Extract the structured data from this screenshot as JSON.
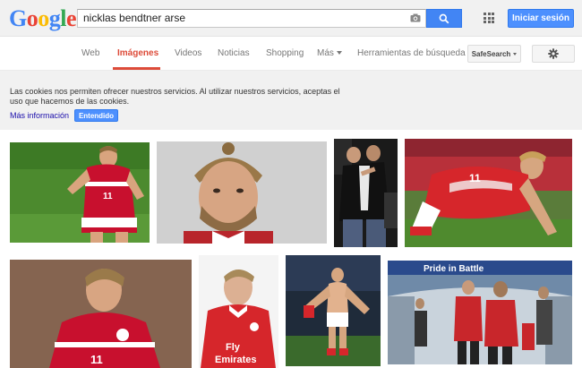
{
  "header": {
    "logo_letters": [
      {
        "ch": "G",
        "color": "#4285f4"
      },
      {
        "ch": "o",
        "color": "#ea4335"
      },
      {
        "ch": "o",
        "color": "#fbbc05"
      },
      {
        "ch": "g",
        "color": "#4285f4"
      },
      {
        "ch": "l",
        "color": "#34a853"
      },
      {
        "ch": "e",
        "color": "#ea4335"
      }
    ],
    "search_value": "nicklas bendtner arse",
    "signin_label": "Iniciar sesión"
  },
  "tabs": [
    {
      "label": "Web",
      "active": false
    },
    {
      "label": "Imágenes",
      "active": true
    },
    {
      "label": "Videos",
      "active": false
    },
    {
      "label": "Noticias",
      "active": false
    },
    {
      "label": "Shopping",
      "active": false
    },
    {
      "label": "Más",
      "active": false
    },
    {
      "label": "Herramientas de búsqueda",
      "active": false
    }
  ],
  "safesearch_label": "SafeSearch",
  "cookie": {
    "text": "Las cookies nos permiten ofrecer nuestros servicios. Al utilizar nuestros servicios, aceptas el uso que hacemos de las cookies.",
    "more_link": "Más información",
    "ok_label": "Entendido"
  },
  "results": {
    "shirt_text_1": "Fly",
    "shirt_text_2": "Emirates",
    "banner_text": "Pride in Battle",
    "shirt_number": "11"
  },
  "colors": {
    "accent_red": "#dd4b39",
    "blue_button": "#4285f4",
    "arsenal_red": "#d6262b",
    "denmark_red": "#c8102e"
  },
  "icons": [
    "camera-icon",
    "search-icon",
    "apps-icon",
    "gear-icon",
    "chevron-down-icon"
  ]
}
